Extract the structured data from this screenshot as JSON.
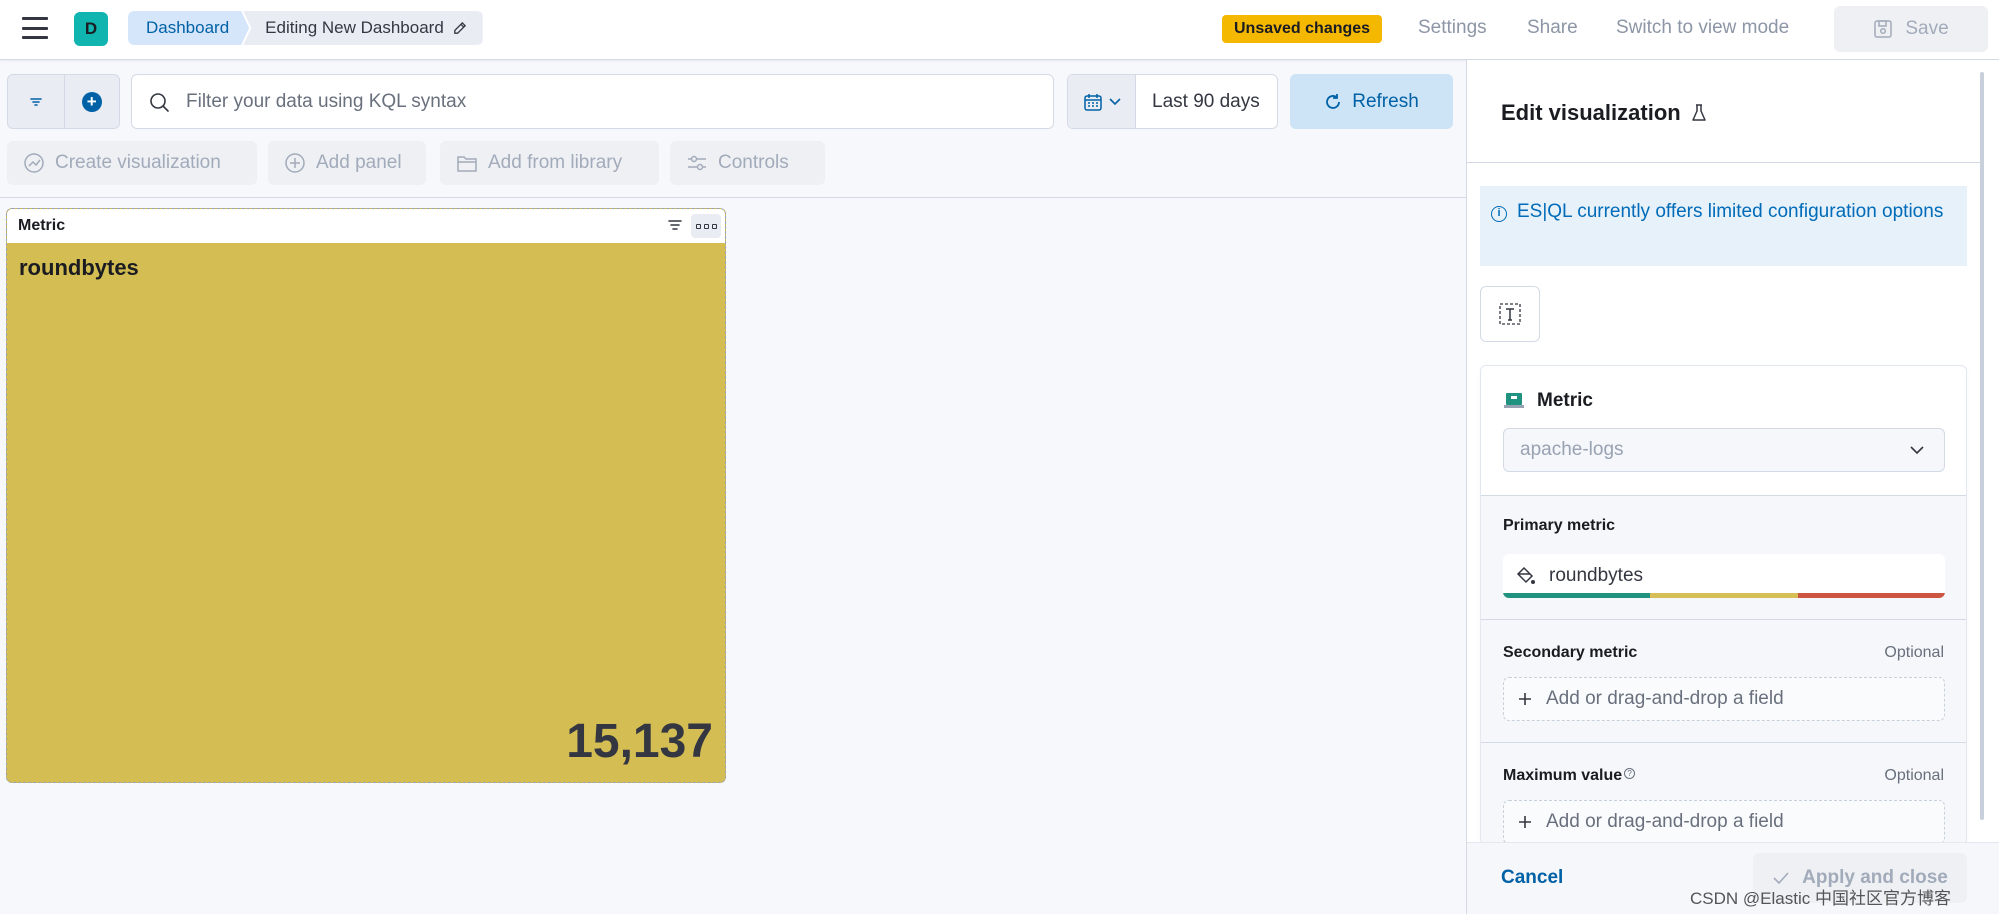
{
  "header": {
    "avatar_letter": "D",
    "breadcrumbs": [
      "Dashboard",
      "Editing New Dashboard"
    ],
    "unsaved_badge": "Unsaved changes",
    "links": [
      "Settings",
      "Share",
      "Switch to view mode"
    ],
    "save_label": "Save"
  },
  "query_bar": {
    "search_placeholder": "Filter your data using KQL syntax",
    "date_range": "Last 90 days",
    "refresh_label": "Refresh"
  },
  "toolbar": {
    "create_visualization": "Create visualization",
    "add_panel": "Add panel",
    "add_from_library": "Add from library",
    "controls": "Controls"
  },
  "panel": {
    "title": "Metric",
    "metric_name": "roundbytes",
    "metric_value": "15,137",
    "color": "#d4bd52"
  },
  "flyout": {
    "title": "Edit visualization",
    "callout": "ES|QL currently offers limited configuration options",
    "layer_title": "Metric",
    "data_source": "apache-logs",
    "primary_metric_label": "Primary metric",
    "primary_metric_field": "roundbytes",
    "palette": [
      "#209280",
      "#d6bf57",
      "#cc5642"
    ],
    "secondary_metric_label": "Secondary metric",
    "secondary_optional": "Optional",
    "secondary_placeholder": "Add or drag-and-drop a field",
    "max_value_label": "Maximum value",
    "max_optional": "Optional",
    "max_placeholder": "Add or drag-and-drop a field",
    "cancel_label": "Cancel",
    "apply_label": "Apply and close"
  },
  "watermark": "CSDN @Elastic 中国社区官方博客"
}
